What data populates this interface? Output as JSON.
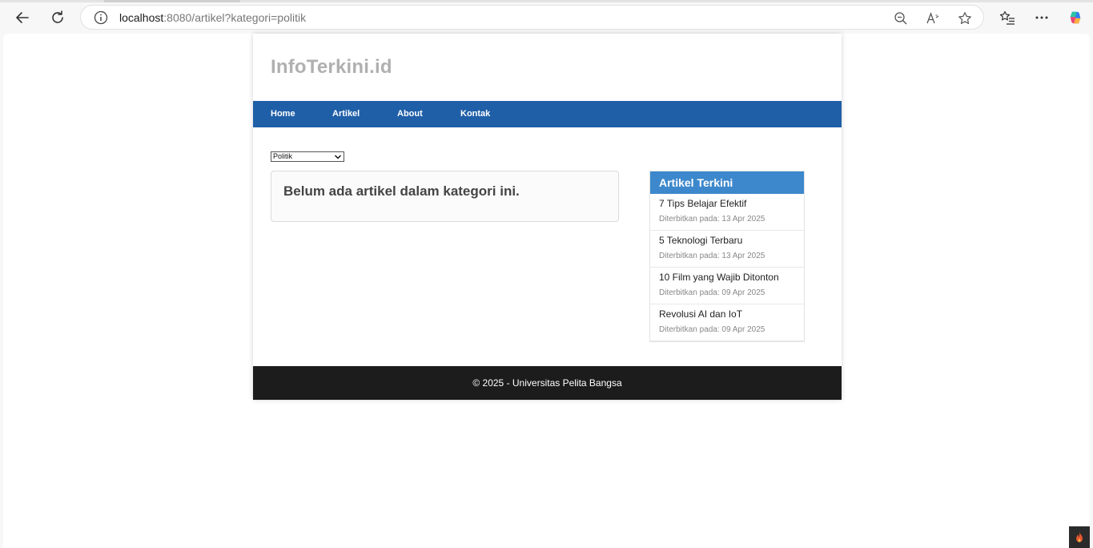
{
  "browser": {
    "url_host": "localhost",
    "url_rest": ":8080/artikel?kategori=politik"
  },
  "site": {
    "title": "InfoTerkini.id",
    "nav": [
      "Home",
      "Artikel",
      "About",
      "Kontak"
    ]
  },
  "filter": {
    "selected": "Politik"
  },
  "main": {
    "empty_message": "Belum ada artikel dalam kategori ini."
  },
  "sidebar": {
    "heading": "Artikel Terkini",
    "items": [
      {
        "title": "7 Tips Belajar Efektif",
        "date": "Diterbitkan pada: 13 Apr 2025"
      },
      {
        "title": "5 Teknologi Terbaru",
        "date": "Diterbitkan pada: 13 Apr 2025"
      },
      {
        "title": "10 Film yang Wajib Ditonton",
        "date": "Diterbitkan pada: 09 Apr 2025"
      },
      {
        "title": "Revolusi AI dan IoT",
        "date": "Diterbitkan pada: 09 Apr 2025"
      }
    ]
  },
  "footer": {
    "text": "© 2025 - Universitas Pelita Bangsa"
  },
  "colors": {
    "nav_bg": "#1f5fa8",
    "sidebar_header": "#3d88cc",
    "footer_bg": "#1c1c1c"
  }
}
